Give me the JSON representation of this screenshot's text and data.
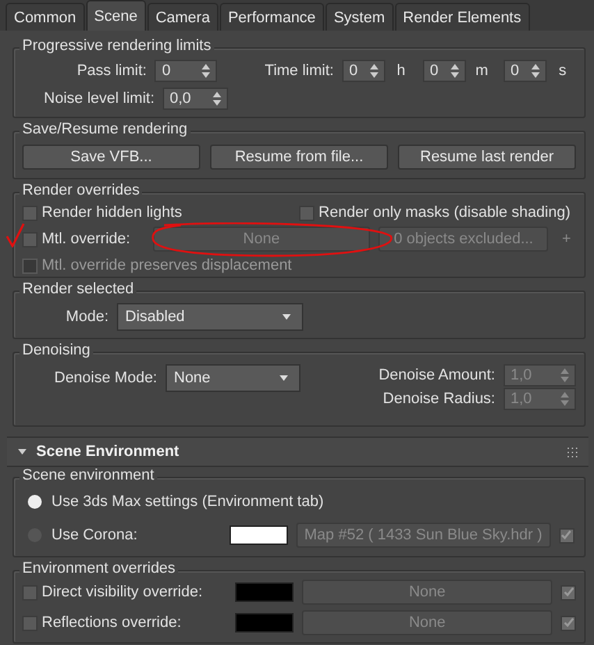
{
  "tabs": [
    {
      "label": "Common",
      "selected": false
    },
    {
      "label": "Scene",
      "selected": true
    },
    {
      "label": "Camera",
      "selected": false
    },
    {
      "label": "Performance",
      "selected": false
    },
    {
      "label": "System",
      "selected": false
    },
    {
      "label": "Render Elements",
      "selected": false
    }
  ],
  "progressive": {
    "title": "Progressive rendering limits",
    "pass_label": "Pass limit:",
    "pass_value": "0",
    "time_label": "Time limit:",
    "time_parts": [
      {
        "value": "0",
        "unit": "h"
      },
      {
        "value": "0",
        "unit": "m"
      },
      {
        "value": "0",
        "unit": "s"
      }
    ],
    "noise_label": "Noise level limit:",
    "noise_value": "0,0"
  },
  "save_resume": {
    "title": "Save/Resume rendering",
    "buttons": [
      "Save VFB...",
      "Resume from file...",
      "Resume last render"
    ]
  },
  "overrides": {
    "title": "Render overrides",
    "hidden_lights": {
      "label": "Render hidden lights",
      "checked": false
    },
    "only_masks": {
      "label": "Render only masks (disable shading)",
      "checked": false
    },
    "mtl": {
      "label": "Mtl. override:",
      "checked": false,
      "map": "None",
      "excluded": "0 objects excluded...",
      "add": "+"
    },
    "preserve": {
      "label": "Mtl. override preserves displacement",
      "checked": false,
      "disabled": true
    }
  },
  "render_selected": {
    "title": "Render selected",
    "mode_label": "Mode:",
    "mode": "Disabled"
  },
  "denoising": {
    "title": "Denoising",
    "mode_label": "Denoise Mode:",
    "mode": "None",
    "amount_label": "Denoise Amount:",
    "amount": "1,0",
    "radius_label": "Denoise Radius:",
    "radius": "1,0"
  },
  "rollout": {
    "title": "Scene Environment",
    "expanded": true
  },
  "scene_env": {
    "title": "Scene environment",
    "options": [
      {
        "label": "Use 3ds Max settings (Environment tab)",
        "selected": true
      },
      {
        "label": "Use Corona:",
        "selected": false,
        "color": "#ffffff",
        "map": "Map #52  ( 1433 Sun Blue Sky.hdr )",
        "map_checked": true
      }
    ]
  },
  "env_overrides": {
    "title": "Environment overrides",
    "rows": [
      {
        "label": "Direct visibility override:",
        "checked": false,
        "color": "#000000",
        "map": "None",
        "map_checked": true
      },
      {
        "label": "Reflections override:",
        "checked": false,
        "color": "#000000",
        "map": "None",
        "map_checked": true
      }
    ]
  }
}
